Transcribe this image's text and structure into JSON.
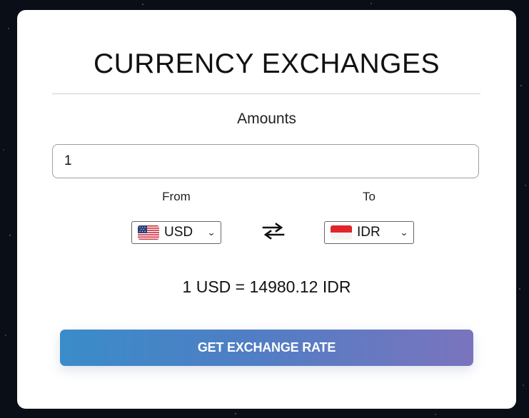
{
  "header": {
    "title": "CURRENCY EXCHANGES"
  },
  "amount": {
    "label": "Amounts",
    "value": "1"
  },
  "from": {
    "label": "From",
    "currency": "USD",
    "flag": "us-flag"
  },
  "to": {
    "label": "To",
    "currency": "IDR",
    "flag": "id-flag"
  },
  "swap": {
    "icon": "swap-arrows-icon"
  },
  "result": {
    "text": "1 USD = 14980.12 IDR"
  },
  "actions": {
    "get_rate_label": "GET EXCHANGE RATE"
  },
  "colors": {
    "button_start": "#3a8cc9",
    "button_end": "#7a74be",
    "background": "#0a0e16"
  }
}
